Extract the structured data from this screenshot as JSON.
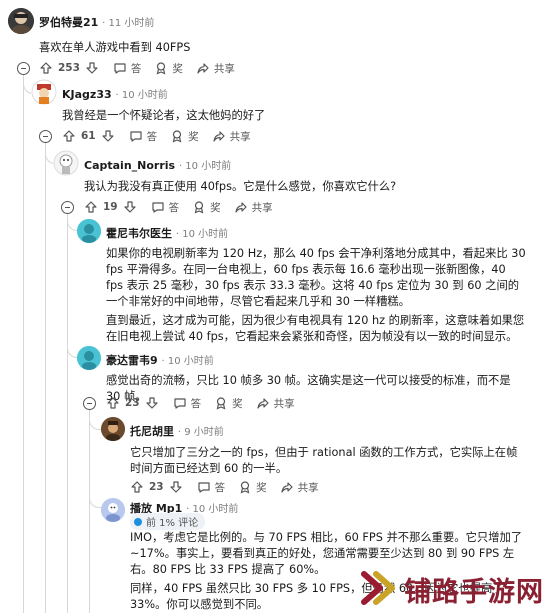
{
  "actions": {
    "reply": "答",
    "award": "奖",
    "share": "共享"
  },
  "comments": [
    {
      "username": "罗伯特曼21",
      "time": "· 11 小时前",
      "body": "喜欢在单人游戏中看到 40FPS",
      "votes": "253"
    },
    {
      "username": "KJagz33",
      "time": "· 10 小时前",
      "body": "我曾经是一个怀疑论者，这太他妈的好了",
      "votes": "61"
    },
    {
      "username": "Captain_Norris",
      "time": "· 10 小时前",
      "body": "我认为我没有真正使用 40fps。它是什么感觉，你喜欢它什么?",
      "votes": "19"
    },
    {
      "username": "霍尼韦尔医生",
      "time": "· 10 小时前",
      "body": [
        "如果你的电视刷新率为 120 Hz，那么 40 fps 会干净利落地分成其中，看起来比 30 fps 平滑得多。在同一台电视上，60 fps 表示每 16.6 毫秒出现一张新图像，40 fps 表示 25 毫秒，30 fps 表示 33.3 毫秒。这将 40 fps 定位为 30 到 60 之间的一个非常好的中间地带，尽管它看起来几乎和 30 一样糟糕。",
        "直到最近，这才成为可能，因为很少有电视具有 120 hz 的刷新率，这意味着如果您在旧电视上尝试 40 fps，它看起来会紧张和奇怪，因为帧没有以一致的时间显示。"
      ]
    },
    {
      "username": "豪达雷韦9",
      "time": "· 10 小时前",
      "body": "感觉出奇的流畅，只比 10 帧多 30 帧。这确实是这一代可以接受的标准，而不是 30 帧。",
      "votes": "23"
    },
    {
      "username": "托尼胡里",
      "time": "· 9 小时前",
      "body": "它只增加了三分之一的 fps，但由于 rational 函数的工作方式，它实际上在帧时间方面已经达到 60 的一半。",
      "votes": "23"
    },
    {
      "username": "播放 Mp1",
      "time": "· 10 小时前",
      "flair": "前 1% 评论",
      "body": [
        "IMO，考虑它是比例的。与 70 FPS 相比，60 FPS 并不那么重要。它只增加了 ~17%。事实上，要看到真正的好处，您通常需要至少达到 80 到 90 FPS 左右。80 FPS 比 33 FPS 提高了 60%。",
        "同样，40 FPS 虽然只比 30 FPS 多 10 FPS，但仍然 60，因为它也提高了 33%。你可以感觉到不同。"
      ]
    }
  ],
  "watermark": {
    "text": "铺路手游网"
  }
}
